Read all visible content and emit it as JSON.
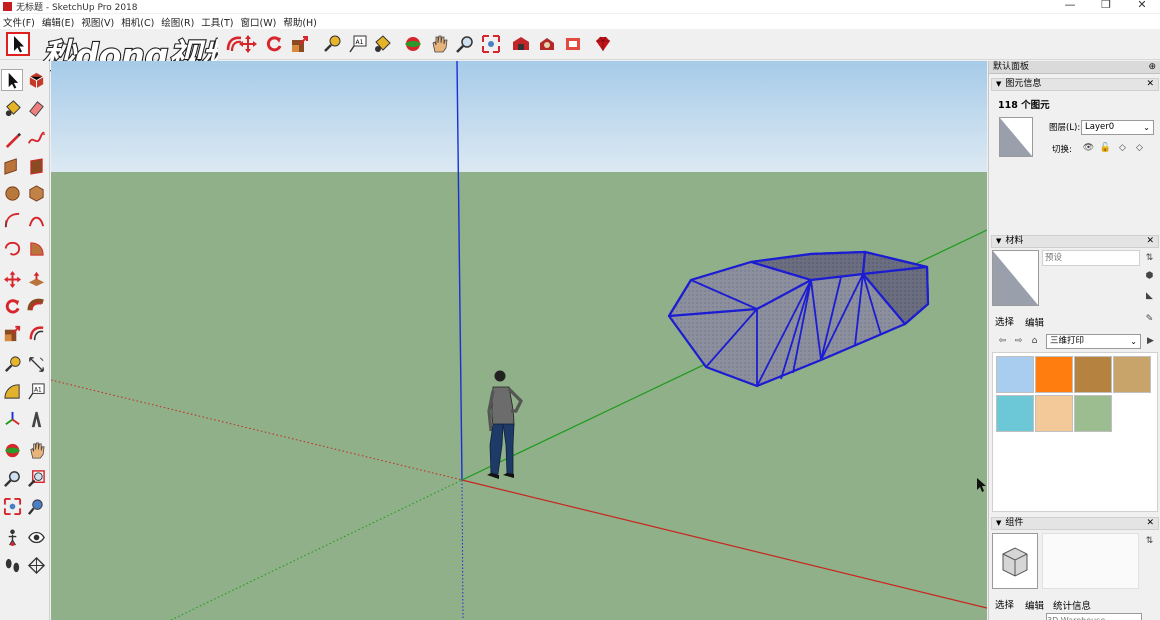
{
  "window": {
    "title": "无标题 - SketchUp Pro 2018",
    "controls": {
      "minimize": "—",
      "restore": "❐",
      "close": "✕"
    }
  },
  "menus": [
    "文件(F)",
    "编辑(E)",
    "视图(V)",
    "相机(C)",
    "绘图(R)",
    "工具(T)",
    "窗口(W)",
    "帮助(H)"
  ],
  "watermark": {
    "text": "秒dong视频"
  },
  "tray": {
    "title": "默认面板",
    "pin_glyph": "⊕",
    "entity_info": {
      "header": "图元信息",
      "count": "118 个图元",
      "layer_label": "图层(L):",
      "layer_value": "Layer0",
      "toggle_label": "切换:"
    },
    "materials": {
      "header": "材料",
      "preset_label": "预设",
      "tab_select": "选择",
      "tab_edit": "编辑",
      "collection": "三维打印",
      "swatches": [
        "#a9cdef",
        "#ff7c0e",
        "#b5823f",
        "#c9a46a",
        "#6cc8d6",
        "#f4c999",
        "#9bbd8f"
      ]
    },
    "components": {
      "header": "组件",
      "tab_select": "选择",
      "tab_edit": "编辑",
      "tab_stats": "统计信息",
      "search_placeholder": "3D Warehouse"
    }
  },
  "viewport": {
    "sky_top": "#a6cbe8",
    "sky_bottom": "#dce9f3",
    "ground": "#8fb088",
    "model_edge": "#1c1cd2",
    "model_face": "#8b8f9e",
    "axis_blue": "#1a2fd6",
    "axis_red": "#c8261f",
    "axis_green": "#1b9a1b"
  },
  "colors": {
    "tool_red": "#d7262b",
    "tool_tan": "#c68a3c",
    "highlight": "#e01f1f"
  }
}
